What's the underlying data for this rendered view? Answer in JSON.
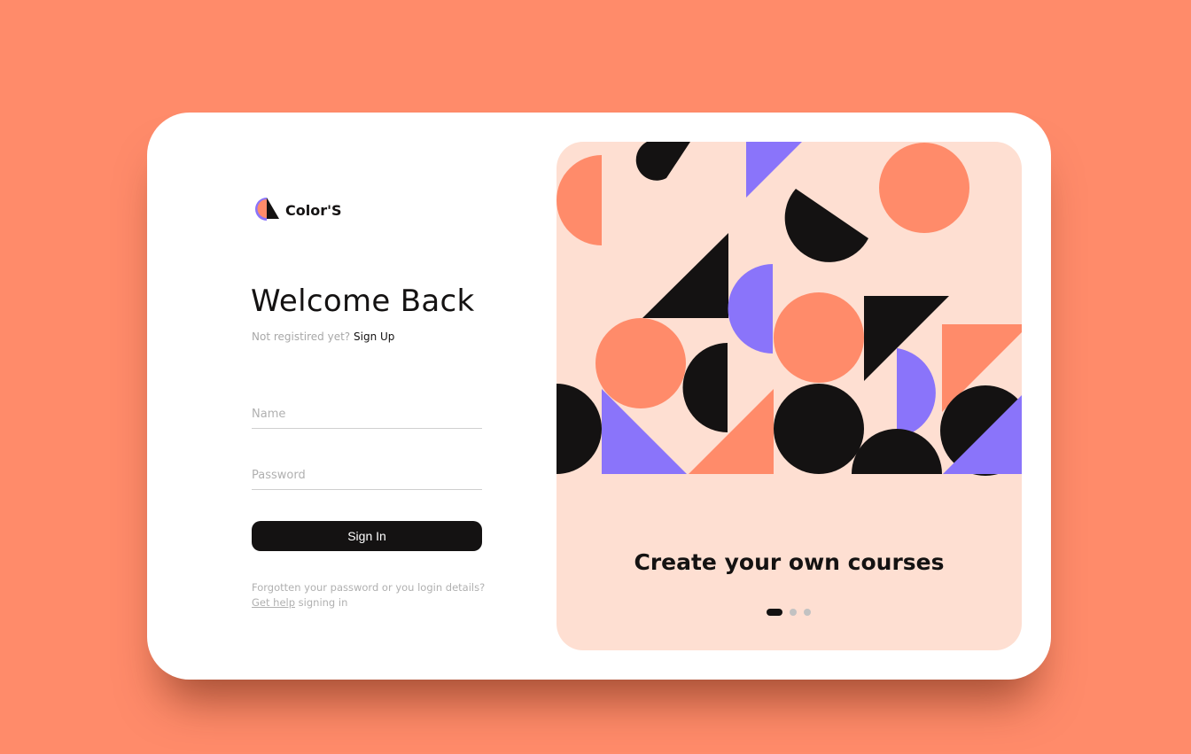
{
  "brand": {
    "name": "Color'S",
    "logo_icon": "color-logo-icon"
  },
  "login": {
    "title": "Welcome Back",
    "not_registered": "Not registired yet?",
    "sign_up": "Sign Up",
    "name_placeholder": "Name",
    "password_placeholder": "Password",
    "sign_in": "Sign In",
    "help_line1": "Forgotten your password or you login details?",
    "help_link": "Get help",
    "help_line2_rest": "signing in"
  },
  "promo": {
    "title": "Create your own courses",
    "slides_total": 3,
    "active_slide": 1
  },
  "colors": {
    "background": "#FF8B6A",
    "panel": "#FEDFD2",
    "orange": "#FF8B6A",
    "purple": "#8A74FA",
    "black": "#141212"
  }
}
